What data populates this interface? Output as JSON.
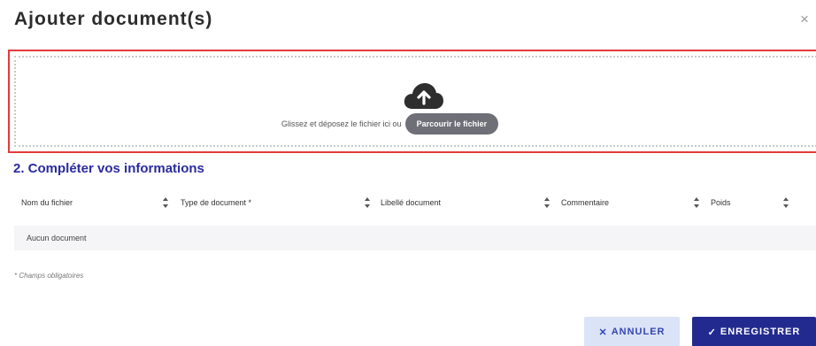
{
  "modal": {
    "title": "Ajouter document(s)",
    "close_icon": "close-icon",
    "close_glyph": "×"
  },
  "dropzone": {
    "icon": "cloud-upload-icon",
    "instruction": "Glissez et déposez le fichier ici ou",
    "browse_label": "Parcourir le fichier",
    "highlight_color": "#e53a3a"
  },
  "section": {
    "title": "2. Compléter vos informations"
  },
  "table": {
    "columns": [
      {
        "label": "Nom du fichier"
      },
      {
        "label": "Type de document *"
      },
      {
        "label": "Libellé document"
      },
      {
        "label": "Commentaire"
      },
      {
        "label": "Poids"
      }
    ],
    "empty_message": "Aucun document"
  },
  "footnote": "* Champs obligatoires",
  "actions": {
    "cancel_label": "ANNULER",
    "cancel_glyph": "✕",
    "save_label": "ENREGISTRER",
    "save_glyph": "✓"
  },
  "colors": {
    "accent": "#232a8f",
    "section_title": "#2a2a9e",
    "cancel_bg": "#dbe3f7"
  }
}
